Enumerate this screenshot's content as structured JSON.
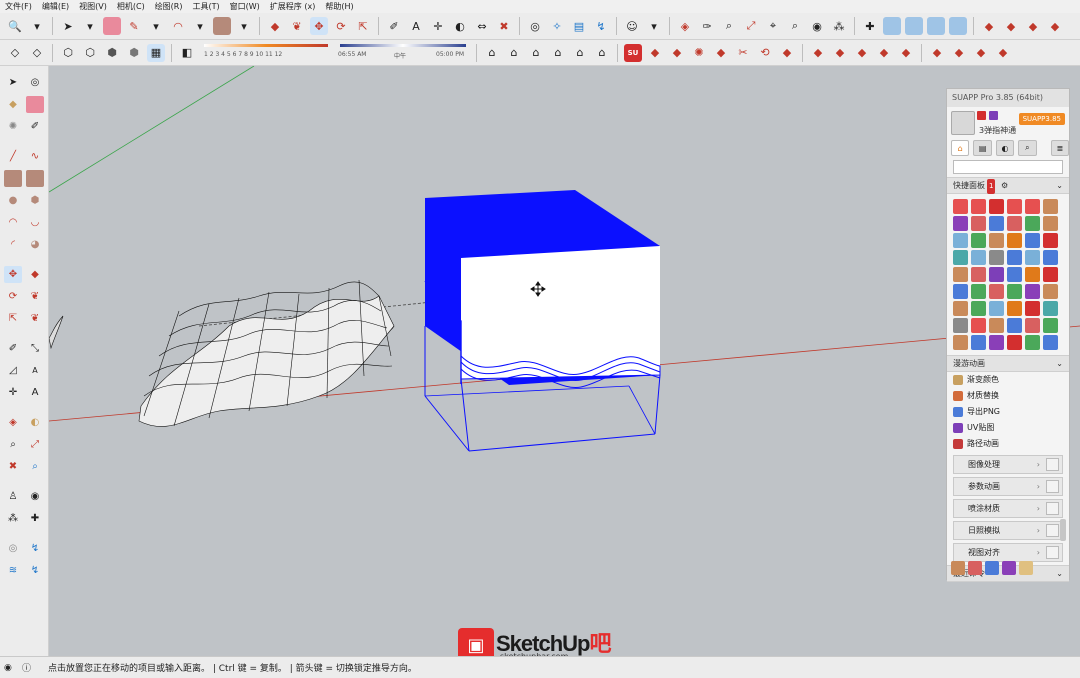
{
  "menu": {
    "items": [
      "文件(F)",
      "编辑(E)",
      "视图(V)",
      "相机(C)",
      "绘图(R)",
      "工具(T)",
      "窗口(W)",
      "扩展程序 (x)",
      "帮助(H)"
    ]
  },
  "toolbar2": {
    "shadow_time_left": "06:55 AM",
    "shadow_time_mid": "中午",
    "shadow_time_right": "05:00 PM",
    "month_ticks": "1  2  3  4  5  6  7  8  9  10  11  12"
  },
  "panel": {
    "title": "SUAPP Pro 3.85 (64bit)",
    "username": "3弹指神通",
    "version_badge": "SUAPP3.85",
    "quick_panel_label": "快捷面板",
    "quick_panel_badge": "1",
    "roam_anim_label": "漫游动画",
    "list_items": [
      {
        "label": "渐变颜色",
        "color": "#c8a060"
      },
      {
        "label": "材质替换",
        "color": "#d26b3a"
      },
      {
        "label": "导出PNG",
        "color": "#4b7bd8"
      },
      {
        "label": "UV贴图",
        "color": "#7d3fb8"
      },
      {
        "label": "路径动画",
        "color": "#c43a3a"
      }
    ],
    "buttons": [
      "图像处理",
      "参数动画",
      "喷涂材质",
      "日照模拟",
      "视图对齐"
    ],
    "recent_label": "最近命令"
  },
  "status": {
    "text": "点击放置您正在移动的项目或输入距离。 | Ctrl 键 = 复制。 | 箭头键 = 切换锁定推导方向。"
  },
  "watermark": {
    "logo_text": "SketchUp",
    "logo_suffix": "吧",
    "url": "sketchupbar.com"
  },
  "colors": {
    "axis_red": "#c0392b",
    "axis_green": "#3aa54a",
    "selection_blue": "#0b10ff",
    "accent_orange": "#f08a24"
  }
}
